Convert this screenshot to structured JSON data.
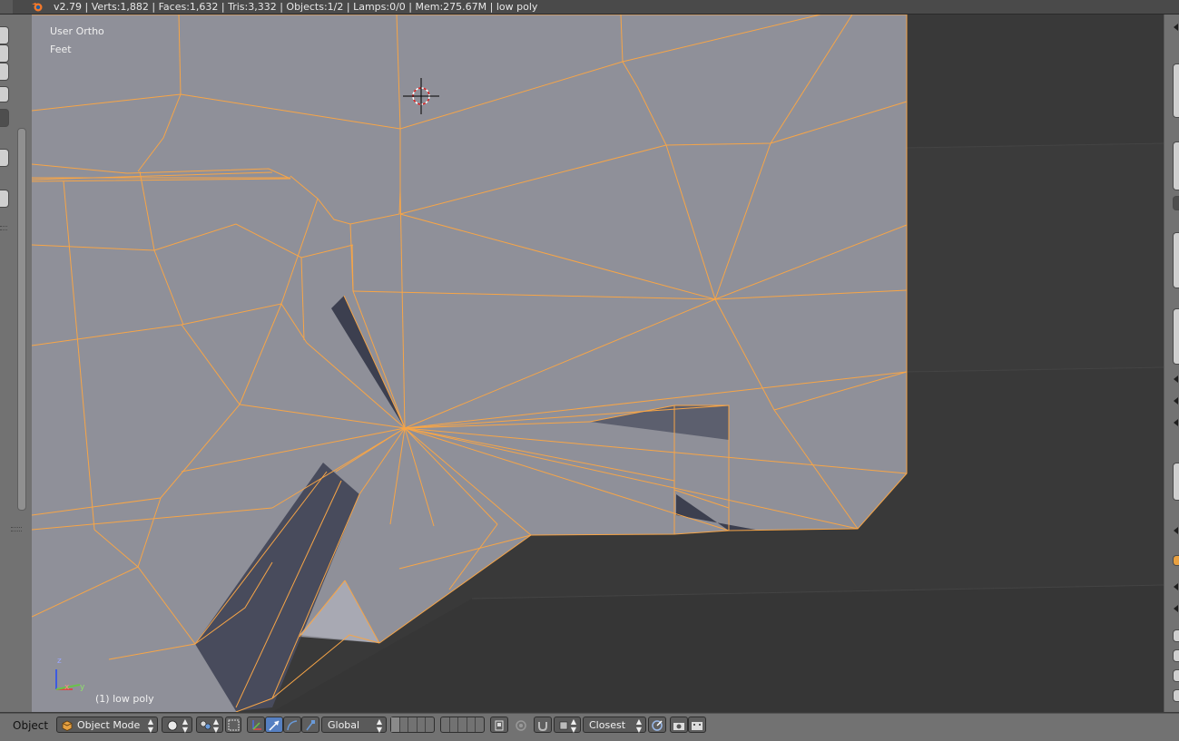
{
  "infobar": {
    "stats": "v2.79 | Verts:1,882 | Faces:1,632 | Tris:3,332 | Objects:1/2 | Lamps:0/0 | Mem:275.67M | low poly"
  },
  "viewport": {
    "view_name": "User Ortho",
    "units": "Feet",
    "object_label": "(1) low poly",
    "axis_z": "z",
    "axis_y": "y",
    "axis_x": "x",
    "colors": {
      "wire": "#f7a547",
      "face": "#8f9099",
      "background": "#393939",
      "shadow": "#3c3f4f"
    }
  },
  "header": {
    "menu_object": "Object",
    "mode": "Object Mode",
    "transform_orientation": "Global",
    "snap_target": "Closest",
    "icons": [
      "object-mode-cube-icon",
      "viewport-shading-icon",
      "pivot-point-icon",
      "manipulator-icon",
      "translate-icon",
      "rotate-icon",
      "scale-icon",
      "layers-grid",
      "lock-camera-icon",
      "proportional-edit-icon",
      "snap-magnet-icon",
      "snap-element-icon",
      "render-camera-icon",
      "render-animation-icon"
    ]
  }
}
